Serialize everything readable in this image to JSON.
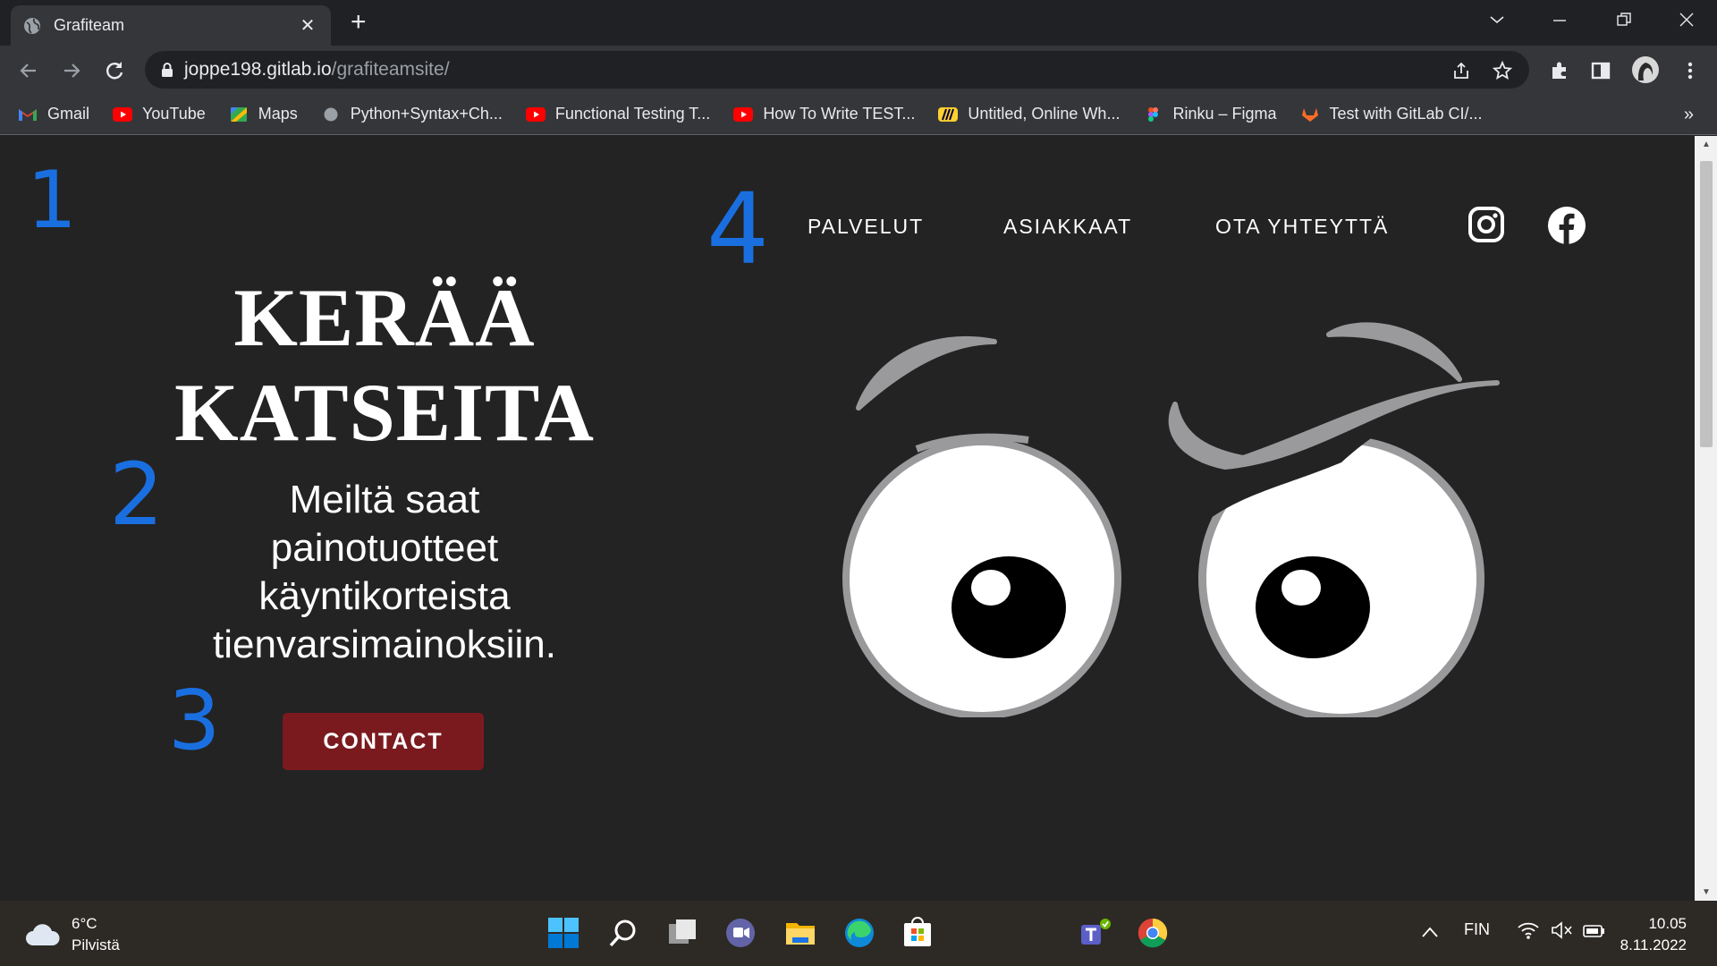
{
  "browser": {
    "tab_title": "Grafiteam",
    "url_host": "joppe198.gitlab.io",
    "url_path": "/grafiteamsite/",
    "bookmarks": [
      {
        "label": "Gmail",
        "icon": "gmail-icon"
      },
      {
        "label": "YouTube",
        "icon": "youtube-icon"
      },
      {
        "label": "Maps",
        "icon": "maps-icon"
      },
      {
        "label": "Python+Syntax+Ch...",
        "icon": "globe-icon"
      },
      {
        "label": "Functional Testing T...",
        "icon": "youtube-icon"
      },
      {
        "label": "How To Write TEST...",
        "icon": "youtube-icon"
      },
      {
        "label": "Untitled, Online Wh...",
        "icon": "miro-icon"
      },
      {
        "label": "Rinku – Figma",
        "icon": "figma-icon"
      },
      {
        "label": "Test with GitLab CI/...",
        "icon": "gitlab-icon"
      }
    ],
    "bookmarks_more": "»"
  },
  "site": {
    "hero_title_line1": "KERÄÄ",
    "hero_title_line2": "KATSEITA",
    "hero_subtitle_lines": [
      "Meiltä saat",
      "painotuotteet",
      "käyntikorteista",
      "tienvarsimainoksiin."
    ],
    "contact_label": "CONTACT",
    "nav": [
      "PALVELUT",
      "ASIAKKAAT",
      "OTA YHTEYTTÄ"
    ],
    "social": [
      "instagram-icon",
      "facebook-icon"
    ]
  },
  "annotations": [
    "1",
    "2",
    "3",
    "4"
  ],
  "taskbar": {
    "temperature": "6°C",
    "weather_desc": "Pilvistä",
    "language": "FIN",
    "time": "10.05",
    "date": "8.11.2022"
  },
  "colors": {
    "page_bg": "#232323",
    "button_bg": "#7a1a1f",
    "annotation": "#1a6fe0",
    "eye_outline": "#9a9a9c"
  }
}
